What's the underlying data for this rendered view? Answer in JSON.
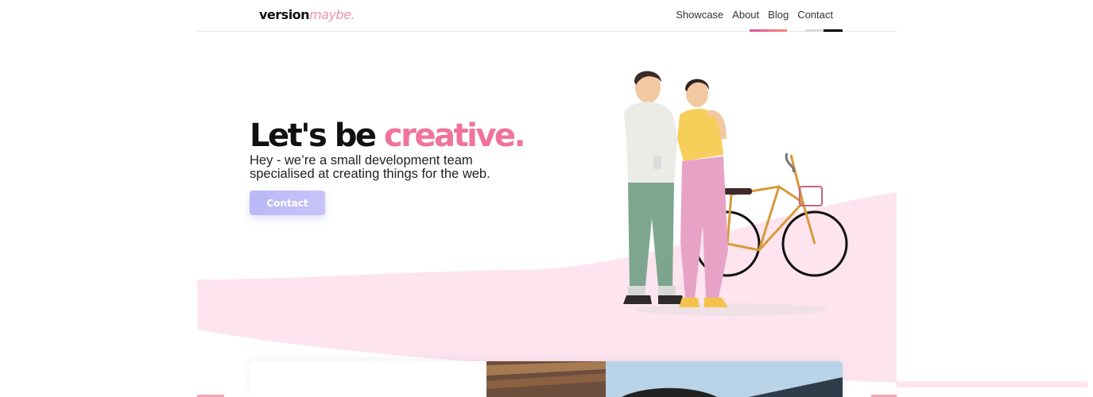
{
  "header": {
    "logo_main": "version",
    "logo_accent": "maybe.",
    "nav": [
      {
        "label": "Showcase"
      },
      {
        "label": "About"
      },
      {
        "label": "Blog"
      },
      {
        "label": "Contact"
      }
    ]
  },
  "hero": {
    "title_main": "Let's be",
    "title_accent": "creative.",
    "subtitle_line1": "Hey - we’re a small development team",
    "subtitle_line2": "specialised at creating things for the web.",
    "cta_label": "Contact"
  },
  "colors": {
    "accent_pink": "#f0739e",
    "button": "#bdbbf7",
    "background_wave": "#fde4ee"
  }
}
